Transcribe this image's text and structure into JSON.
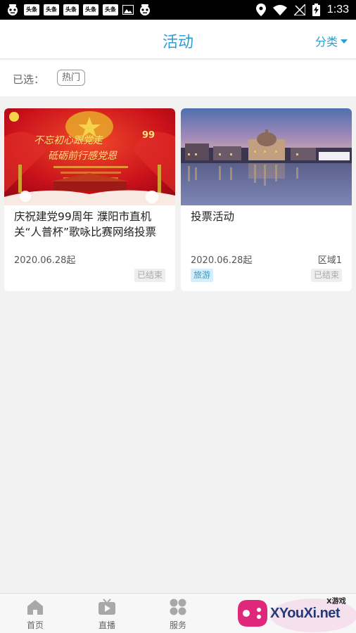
{
  "status_bar": {
    "time": "1:33",
    "notification_icons": [
      "robot-icon",
      "news-icon",
      "news-icon",
      "news-icon",
      "news-icon",
      "news-icon",
      "image-icon",
      "robot-icon"
    ],
    "news_icon_text": "头条"
  },
  "header": {
    "title": "活动",
    "category_label": "分类"
  },
  "filter": {
    "label": "已选：",
    "selected_tag": "热门"
  },
  "activities": [
    {
      "title": "庆祝建党99周年 濮阳市直机关“人普杯”歌咏比赛网络投票",
      "date": "2020.06.28起",
      "status": "已结束",
      "image_lettering": [
        "不忘初心跟党走",
        "砥砺前行感党恩",
        "99"
      ]
    },
    {
      "title": "投票活动",
      "date": "2020.06.28起",
      "area": "区域1",
      "tag": "旅游",
      "status": "已结束"
    }
  ],
  "bottom_nav": {
    "items": [
      {
        "label": "首页",
        "icon": "home-icon"
      },
      {
        "label": "直播",
        "icon": "live-tv-icon"
      },
      {
        "label": "服务",
        "icon": "services-icon"
      }
    ]
  },
  "watermark": {
    "text": "XYouXi.net",
    "small_text": "X游戏"
  },
  "colors": {
    "accent": "#2a9fd6",
    "background": "#f2f2f2",
    "status_bar": "#000000"
  }
}
